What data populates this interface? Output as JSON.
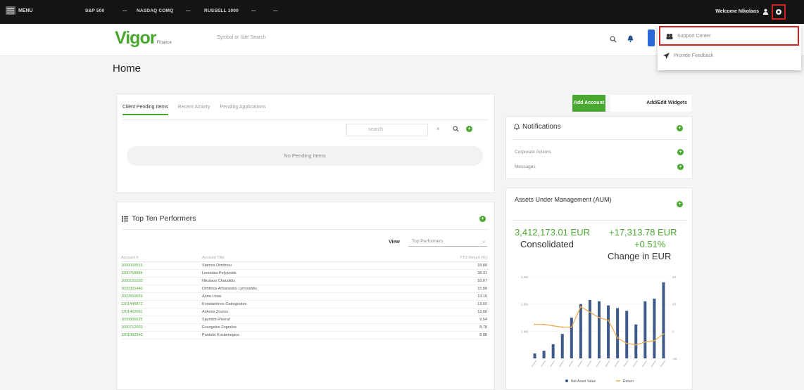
{
  "topbar": {
    "menu_label": "MENU",
    "tickers": [
      {
        "name": "S&P 500",
        "value": "—"
      },
      {
        "name": "NASDAQ COMQ",
        "value": "—"
      },
      {
        "name": "RUSSELL 1000",
        "value": "—"
      },
      {
        "name": "",
        "value": "—"
      }
    ],
    "welcome": "Welcome Nikolaos"
  },
  "header": {
    "logo": "Vigor",
    "logo_sub": "Finance",
    "search_placeholder": "Symbol or Site Search"
  },
  "dropdown": {
    "items": [
      {
        "label": "Support Center",
        "icon": "support-center-icon"
      },
      {
        "label": "Provide Feedback",
        "icon": "paper-plane-icon"
      }
    ]
  },
  "page_title": "Home",
  "pending": {
    "tabs": [
      "Client Pending Items",
      "Recent Activity",
      "Pending Applications"
    ],
    "search_placeholder": "search",
    "empty_message": "No Pending Items"
  },
  "performers": {
    "title": "Top Ten Performers",
    "view_label": "View",
    "view_option": "Top Performers",
    "columns": [
      "Account #",
      "Account Title",
      "YTD Return (%)"
    ],
    "rows": [
      {
        "account": "1000000515",
        "title": "Stamos Dimitriou",
        "ret": "18.88"
      },
      {
        "account": "1200768884",
        "title": "Leonidas Polyzoidis",
        "ret": "38.31"
      },
      {
        "account": "1000151020",
        "title": "Nikolaos Charalidis",
        "ret": "16.07"
      },
      {
        "account": "1000301440",
        "title": "Dimitrios Athanasiou Lymouridis",
        "ret": "15.88"
      },
      {
        "account": "1002550659",
        "title": "Anna Linas",
        "ret": "13.10"
      },
      {
        "account": "1201446872",
        "title": "Konstantinos Gatrogiodes",
        "ret": "13.60"
      },
      {
        "account": "1201402091",
        "title": "Antonis Zouros",
        "ret": "12.60"
      },
      {
        "account": "1000006625",
        "title": "Spyridon Pierrat",
        "ret": "9.54"
      },
      {
        "account": "1000712003",
        "title": "Evangelos Zografos",
        "ret": "8.78"
      },
      {
        "account": "1201962340",
        "title": "Pantelis Kostamegios",
        "ret": "8.08"
      }
    ]
  },
  "actions": {
    "add_account": "Add Account",
    "add_edit_widgets": "Add/Edit Widgets"
  },
  "notifications": {
    "title": "Notifications",
    "rows": [
      "Corporate Actions",
      "Messages"
    ]
  },
  "aum": {
    "title": "Assets Under Management (AUM)",
    "value": "3,412,173.01 EUR",
    "value_label": "Consolidated",
    "change": "+17,313.78 EUR",
    "change_pct": "+0.51%",
    "change_label": "Change in EUR"
  },
  "colors": {
    "accent_green": "#4aa830",
    "bar_blue": "#3d5a8a",
    "line_orange": "#f0a64a",
    "highlight_red": "#d32020"
  },
  "chart_data": {
    "type": "bar",
    "categories": [
      "1",
      "2",
      "3",
      "4",
      "5",
      "6",
      "7",
      "8",
      "9",
      "10",
      "11",
      "12",
      "13",
      "14",
      "15"
    ],
    "series": [
      {
        "name": "Net Asset Value",
        "type": "bar",
        "values": [
          0.18,
          0.28,
          0.52,
          0.9,
          1.5,
          2.0,
          2.15,
          2.1,
          1.95,
          1.85,
          1.75,
          1.25,
          2.1,
          2.2,
          2.8
        ]
      },
      {
        "name": "Return",
        "type": "line",
        "values": [
          5,
          5,
          4,
          3,
          3,
          18,
          14,
          10,
          8,
          -5,
          -9,
          -10,
          -8,
          -7,
          -2
        ]
      }
    ],
    "y_left": {
      "min": 0,
      "max": 3,
      "ticks": [
        "",
        "1.0M",
        "2.0M",
        "3.0M"
      ]
    },
    "y_right": {
      "min": -20,
      "max": 40,
      "ticks": [
        "-20",
        "0",
        "20",
        "40"
      ]
    },
    "legend": "bottom"
  }
}
